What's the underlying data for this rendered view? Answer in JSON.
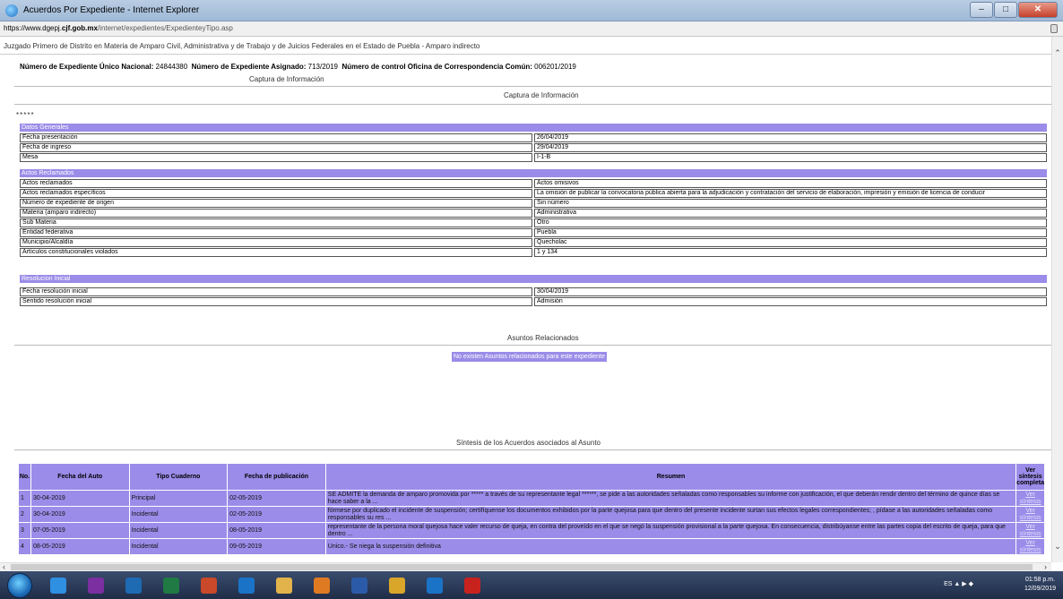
{
  "window": {
    "title": "Acuerdos Por Expediente - Internet Explorer"
  },
  "address": {
    "prefix": "https://www.dgepj.",
    "host": "cjf.gob.mx",
    "path": "/internet/expedientes/ExpedienteyTipo.asp"
  },
  "page": {
    "court": "Juzgado Primero de Distrito en Materia de Amparo Civil, Administrativa y de Trabajo y de Juicios Federales en el Estado de Puebla - Amparo indirecto",
    "exp_unico_label": "Número de Expediente Único Nacional:",
    "exp_unico_value": "24844380",
    "exp_asignado_label": "Número de Expediente Asignado:",
    "exp_asignado_value": "713/2019",
    "control_label": "Número de control Oficina de Correspondencia Común:",
    "control_value": "006201/2019",
    "captura_1": "Captura de Información",
    "captura_2": "Captura de Información",
    "stars": "*****",
    "asuntos_title": "Asuntos Relacionados",
    "no_existen": "No existen Asuntos relacionados para este expediente",
    "sintesis_title": "Síntesis de los Acuerdos asociados al Asunto"
  },
  "datos_generales": {
    "header": "Datos Generales",
    "rows": [
      {
        "k": "Fecha presentación",
        "v": "26/04/2019"
      },
      {
        "k": "Fecha de ingreso",
        "v": "29/04/2019"
      },
      {
        "k": "Mesa",
        "v": "I-1-B"
      }
    ]
  },
  "actos_reclamados": {
    "header": "Actos Reclamados",
    "rows": [
      {
        "k": "Actos reclamados",
        "v": "Actos omisivos"
      },
      {
        "k": "Actos reclamados específicos",
        "v": "La omisión de publicar la convocatoria pública abierta para la adjudicación y contratación del servicio de elaboración, impresión y emisión de licencia de conducir"
      },
      {
        "k": "Número de expediente de origen",
        "v": "Sin número"
      },
      {
        "k": "Materia (amparo indirecto)",
        "v": "Administrativa"
      },
      {
        "k": "Sub Materia",
        "v": "Otro"
      },
      {
        "k": "Entidad federativa",
        "v": "Puebla"
      },
      {
        "k": "Municipio/Alcaldía",
        "v": "Quecholac"
      },
      {
        "k": "Artículos constitucionales violados",
        "v": "1 y 134"
      }
    ]
  },
  "resolucion_inicial": {
    "header": "Resolucion Inicial",
    "rows": [
      {
        "k": "Fecha resolución inicial",
        "v": "30/04/2019"
      },
      {
        "k": "Sentido resolución inicial",
        "v": "Admisión"
      }
    ]
  },
  "acuerdos": {
    "headers": [
      "No.",
      "Fecha del Auto",
      "Tipo Cuaderno",
      "Fecha de publicación",
      "Resumen",
      "Ver síntesis completa"
    ],
    "rows": [
      {
        "no": "1",
        "fecha": "30-04-2019",
        "tipo": "Principal",
        "pub": "02-05-2019",
        "resumen": "SE ADMITE la demanda de amparo promovida por ***** a través de su representante legal ******, se pide a las autoridades señaladas como responsables su informe con justificación, el que deberán rendir dentro del término de quince días se hace saber a la ...",
        "link": "Ver síntesis"
      },
      {
        "no": "2",
        "fecha": "30-04-2019",
        "tipo": "Incidental",
        "pub": "02-05-2019",
        "resumen": "fórmese por duplicado el incidente de suspensión; certifíquense los documentos exhibidos por la parte quejosa para que dentro del presente incidente surtan sus efectos legales correspondientes; , pídase a las autoridades señaladas como responsables su res ...",
        "link": "Ver síntesis"
      },
      {
        "no": "3",
        "fecha": "07-05-2019",
        "tipo": "Incidental",
        "pub": "08-05-2019",
        "resumen": "representante de la persona moral quejosa hace valer recurso de queja, en contra del proveído en el que se negó la suspensión provisional a la parte quejosa. En consecuencia, distribúyanse entre las partes copia del escrito de queja, para que dentro ...",
        "link": "Ver síntesis"
      },
      {
        "no": "4",
        "fecha": "08-05-2019",
        "tipo": "Incidental",
        "pub": "09-05-2019",
        "resumen": "Unico.- Se niega la suspensión definitiva",
        "link": "Ver síntesis"
      }
    ]
  },
  "taskbar": {
    "lang": "ES",
    "time": "01:58 p.m.",
    "date": "12/09/2019",
    "apps": [
      {
        "name": "internet-explorer",
        "color": "#2f8fe0"
      },
      {
        "name": "onenote",
        "color": "#7b2fa0"
      },
      {
        "name": "outlook-blue",
        "color": "#1e6ab3"
      },
      {
        "name": "excel",
        "color": "#1f7a44"
      },
      {
        "name": "powerpoint",
        "color": "#c9492a"
      },
      {
        "name": "outlook",
        "color": "#1a73c6"
      },
      {
        "name": "file-explorer",
        "color": "#e2b34a"
      },
      {
        "name": "paint",
        "color": "#e07a22"
      },
      {
        "name": "word",
        "color": "#2b5ba8"
      },
      {
        "name": "chrome",
        "color": "#d9a62a"
      },
      {
        "name": "outlook-2",
        "color": "#1a73c6"
      },
      {
        "name": "acrobat",
        "color": "#c8221f"
      }
    ]
  }
}
